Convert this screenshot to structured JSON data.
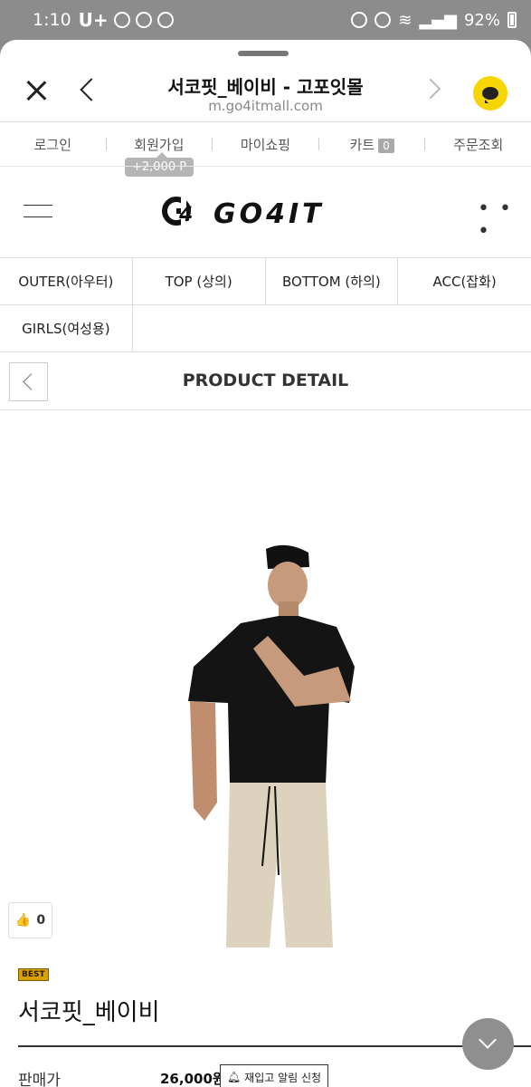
{
  "status_bar": {
    "time": "1:10",
    "carrier": "U+",
    "battery": "92%"
  },
  "browser": {
    "title": "서코핏_베이비 - 고포잇몰",
    "url": "m.go4itmall.com"
  },
  "top_links": {
    "login": "로그인",
    "signup": "회원가입",
    "signup_point": "+2,000 P",
    "mypage": "마이쇼핑",
    "cart": "카트",
    "cart_count": "0",
    "orders": "주문조회"
  },
  "logo": {
    "text": "G4 GO4IT"
  },
  "categories": [
    "OUTER(아우터)",
    "TOP (상의)",
    "BOTTOM (하의)",
    "ACC(잡화)",
    "GIRLS(여성용)"
  ],
  "detail_header": {
    "title": "PRODUCT DETAIL"
  },
  "product": {
    "like_count": "0",
    "badge": "BEST",
    "name": "서코핏_베이비",
    "price_label": "판매가",
    "price": "26,000원",
    "restock_label": "재입고 알림 신청"
  },
  "colors": {
    "kakao": "#f7d500",
    "best_badge": "#d8a200"
  }
}
